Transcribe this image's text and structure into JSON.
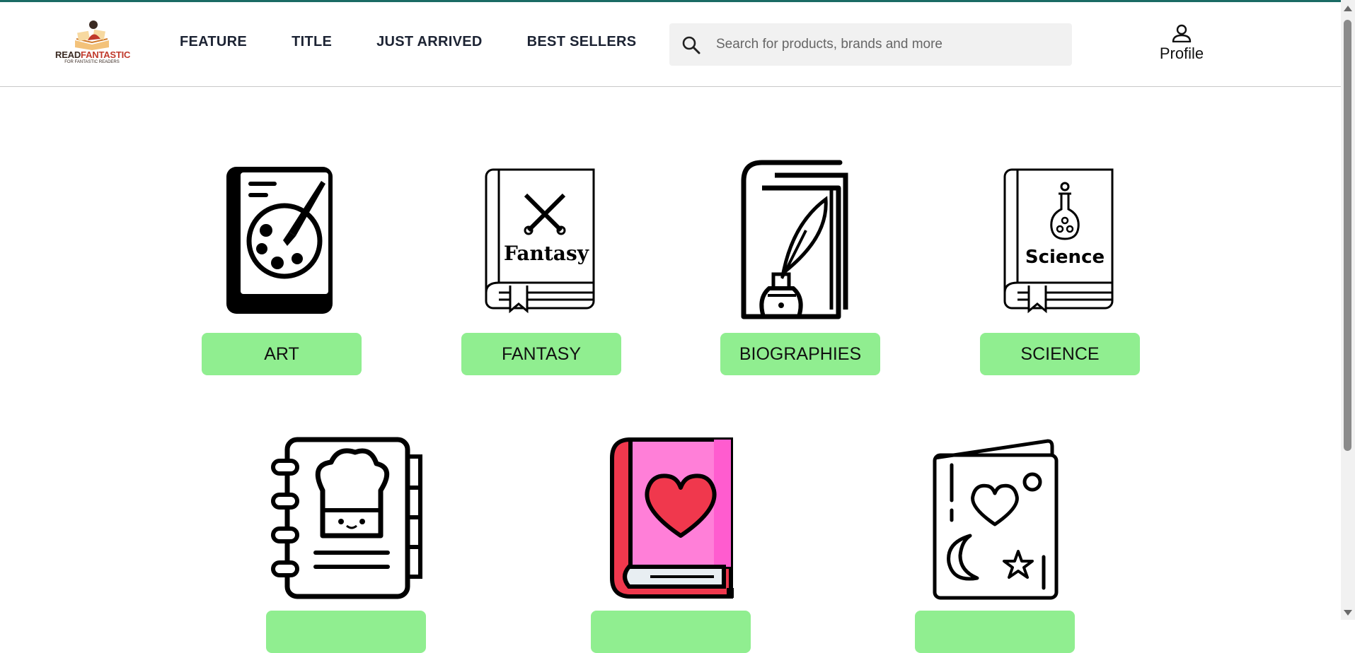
{
  "header": {
    "logo": {
      "brand_a": "READ",
      "brand_b": "FANTASTIC",
      "tagline": "FOR FANTASTIC READERS"
    },
    "nav": [
      "FEATURE",
      "TITLE",
      "JUST ARRIVED",
      "BEST SELLERS"
    ],
    "search": {
      "placeholder": "Search for products, brands and more",
      "value": ""
    },
    "profile_label": "Profile"
  },
  "categories": [
    {
      "label": "ART",
      "icon": "art-book-icon",
      "cover_text": ""
    },
    {
      "label": "FANTASY",
      "icon": "fantasy-book-icon",
      "cover_text": "Fantasy"
    },
    {
      "label": "BIOGRAPHIES",
      "icon": "biography-book-icon",
      "cover_text": ""
    },
    {
      "label": "SCIENCE",
      "icon": "science-book-icon",
      "cover_text": "Science"
    },
    {
      "label": "",
      "icon": "cookbook-icon"
    },
    {
      "label": "",
      "icon": "romance-book-icon"
    },
    {
      "label": "",
      "icon": "greeting-card-icon"
    }
  ],
  "colors": {
    "button_bg": "#90ee90",
    "topline": "#1a6b64",
    "romance_pink": "#ff7fd8",
    "romance_red": "#f0384d"
  }
}
